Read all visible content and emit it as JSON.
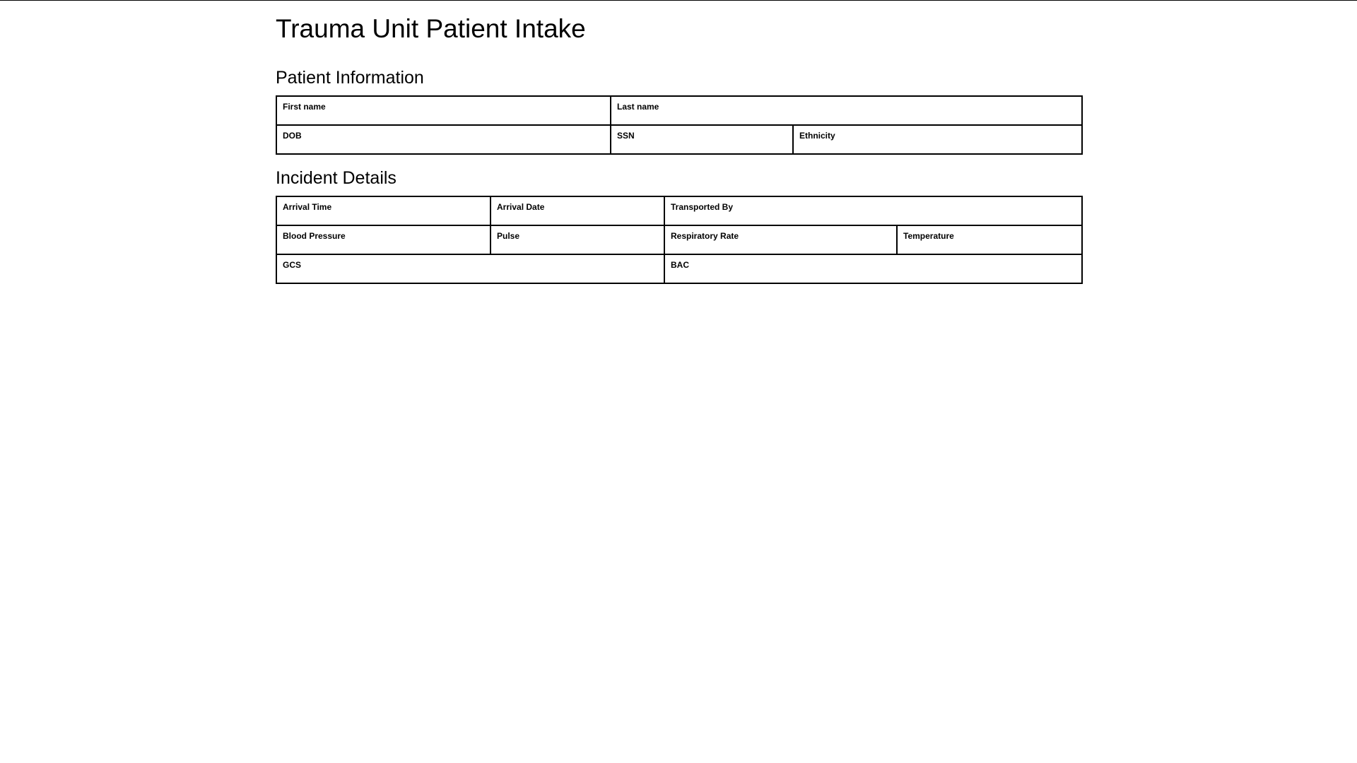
{
  "title": "Trauma Unit Patient Intake",
  "patient_information": {
    "heading": "Patient Information",
    "first_name": {
      "label": "First name",
      "value": ""
    },
    "last_name": {
      "label": "Last name",
      "value": ""
    },
    "dob": {
      "label": "DOB",
      "value": ""
    },
    "ssn": {
      "label": "SSN",
      "value": ""
    },
    "ethnicity": {
      "label": "Ethnicity",
      "value": ""
    }
  },
  "incident_details": {
    "heading": "Incident Details",
    "arrival_time": {
      "label": "Arrival Time",
      "value": ""
    },
    "arrival_date": {
      "label": "Arrival Date",
      "value": ""
    },
    "transported_by": {
      "label": "Transported By",
      "value": ""
    },
    "blood_pressure": {
      "label": "Blood Pressure",
      "value": ""
    },
    "pulse": {
      "label": "Pulse",
      "value": ""
    },
    "respiratory_rate": {
      "label": "Respiratory Rate",
      "value": ""
    },
    "temperature": {
      "label": "Temperature",
      "value": ""
    },
    "gcs": {
      "label": "GCS",
      "value": ""
    },
    "bac": {
      "label": "BAC",
      "value": ""
    }
  }
}
